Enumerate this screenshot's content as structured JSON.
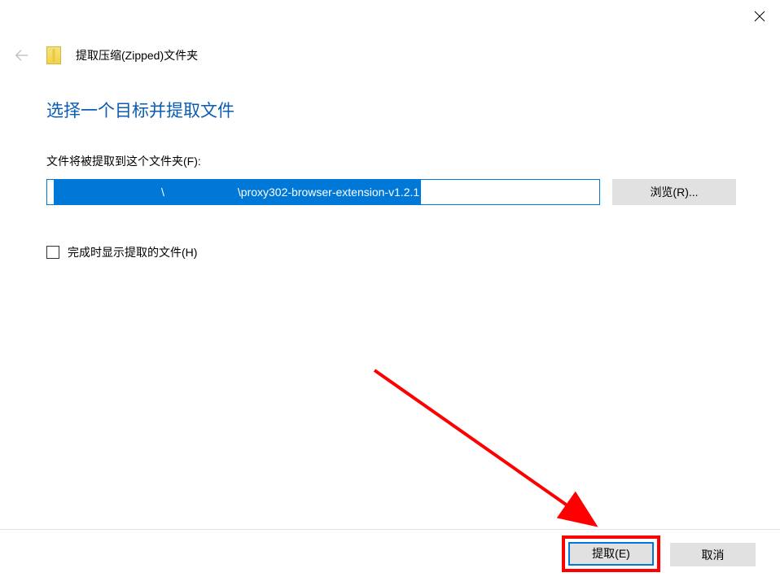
{
  "window": {
    "title": "提取压缩(Zipped)文件夹"
  },
  "content": {
    "heading": "选择一个目标并提取文件",
    "pathLabel": "文件将被提取到这个文件夹(F):",
    "pathValue": "\\proxy302-browser-extension-v1.2.1",
    "browseLabel": "浏览(R)...",
    "checkboxLabel": "完成时显示提取的文件(H)"
  },
  "footer": {
    "extractLabel": "提取(E)",
    "cancelLabel": "取消"
  }
}
